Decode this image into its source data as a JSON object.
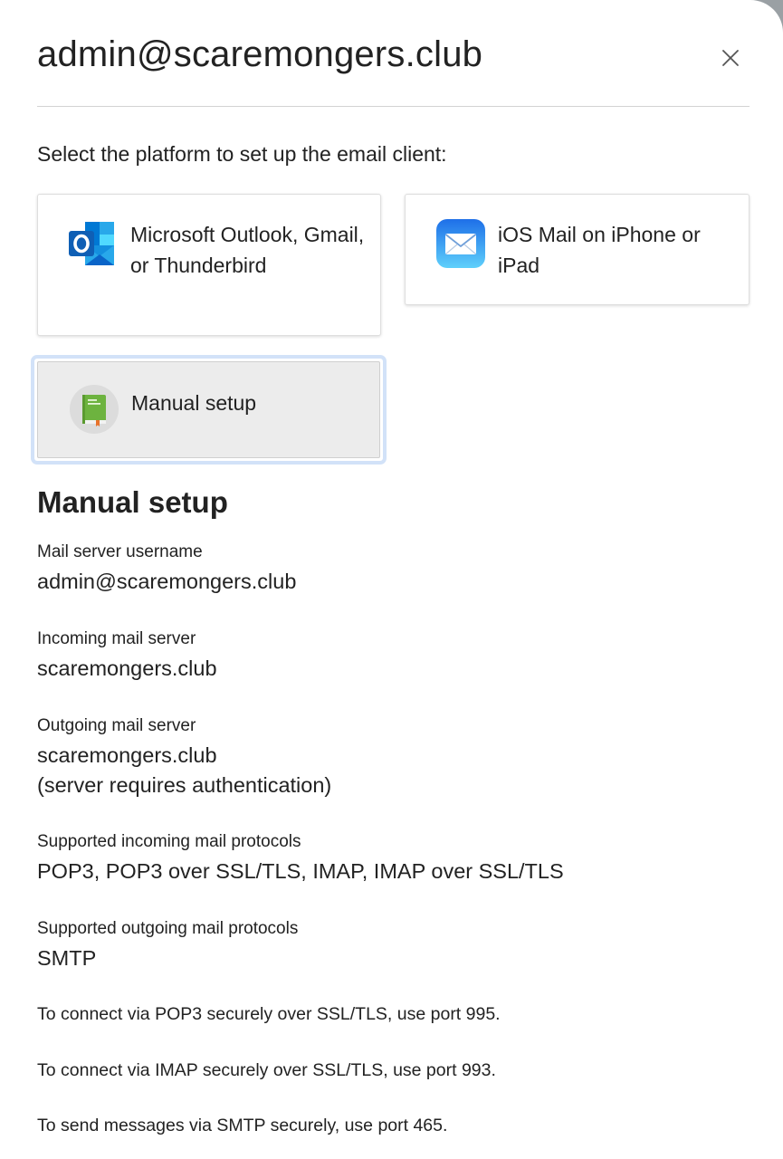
{
  "dialog": {
    "title": "admin@scaremongers.club",
    "close_icon": "close-icon"
  },
  "intro": "Select the platform to set up the email client:",
  "platforms": [
    {
      "icon": "outlook-icon",
      "label": "Microsoft Outlook, Gmail, or Thunderbird"
    },
    {
      "icon": "ios-mail-icon",
      "label": "iOS Mail on iPhone or iPad"
    },
    {
      "icon": "book-icon",
      "label": "Manual setup",
      "selected": true
    }
  ],
  "manual": {
    "title": "Manual setup",
    "fields": [
      {
        "label": "Mail server username",
        "value": "admin@scaremongers.club"
      },
      {
        "label": "Incoming mail server",
        "value": "scaremongers.club"
      },
      {
        "label": "Outgoing mail server",
        "value": "scaremongers.club",
        "note": "(server requires authentication)"
      },
      {
        "label": "Supported incoming mail protocols",
        "value": "POP3, POP3 over SSL/TLS, IMAP, IMAP over SSL/TLS"
      },
      {
        "label": "Supported outgoing mail protocols",
        "value": "SMTP"
      }
    ],
    "ports": [
      "To connect via POP3 securely over SSL/TLS, use port 995.",
      "To connect via IMAP securely over SSL/TLS, use port 993.",
      "To send messages via SMTP securely, use port 465."
    ]
  },
  "colors": {
    "selected_border": "#d2e2f8",
    "selected_bg": "#ececec",
    "outlook_blue": "#0a64c8",
    "ios_blue": "#3b8ef0",
    "book_green": "#6db33f"
  }
}
